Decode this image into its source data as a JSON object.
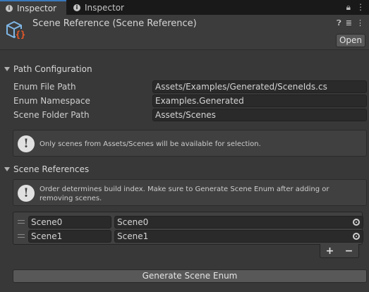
{
  "tabs": [
    {
      "label": "Inspector",
      "active": true
    },
    {
      "label": "Inspector",
      "active": false
    }
  ],
  "header": {
    "title": "Scene Reference (Scene Reference)",
    "open_label": "Open",
    "icon": "scriptable-object-icon"
  },
  "path_config": {
    "section_label": "Path Configuration",
    "fields": [
      {
        "label": "Enum File Path",
        "value": "Assets/Examples/Generated/SceneIds.cs"
      },
      {
        "label": "Enum Namespace",
        "value": "Examples.Generated"
      },
      {
        "label": "Scene Folder Path",
        "value": "Assets/Scenes"
      }
    ],
    "help": "Only scenes from Assets/Scenes will be available for selection."
  },
  "scene_refs": {
    "section_label": "Scene References",
    "help": "Order determines build index. Make sure to Generate Scene Enum after adding or removing scenes.",
    "items": [
      {
        "key": "Scene0",
        "value": "Scene0"
      },
      {
        "key": "Scene1",
        "value": "Scene1"
      }
    ],
    "add_label": "+",
    "remove_label": "−"
  },
  "generate_label": "Generate Scene Enum",
  "colors": {
    "accent": "#3a79bb",
    "background": "#383838",
    "field": "#2a2a2a"
  }
}
